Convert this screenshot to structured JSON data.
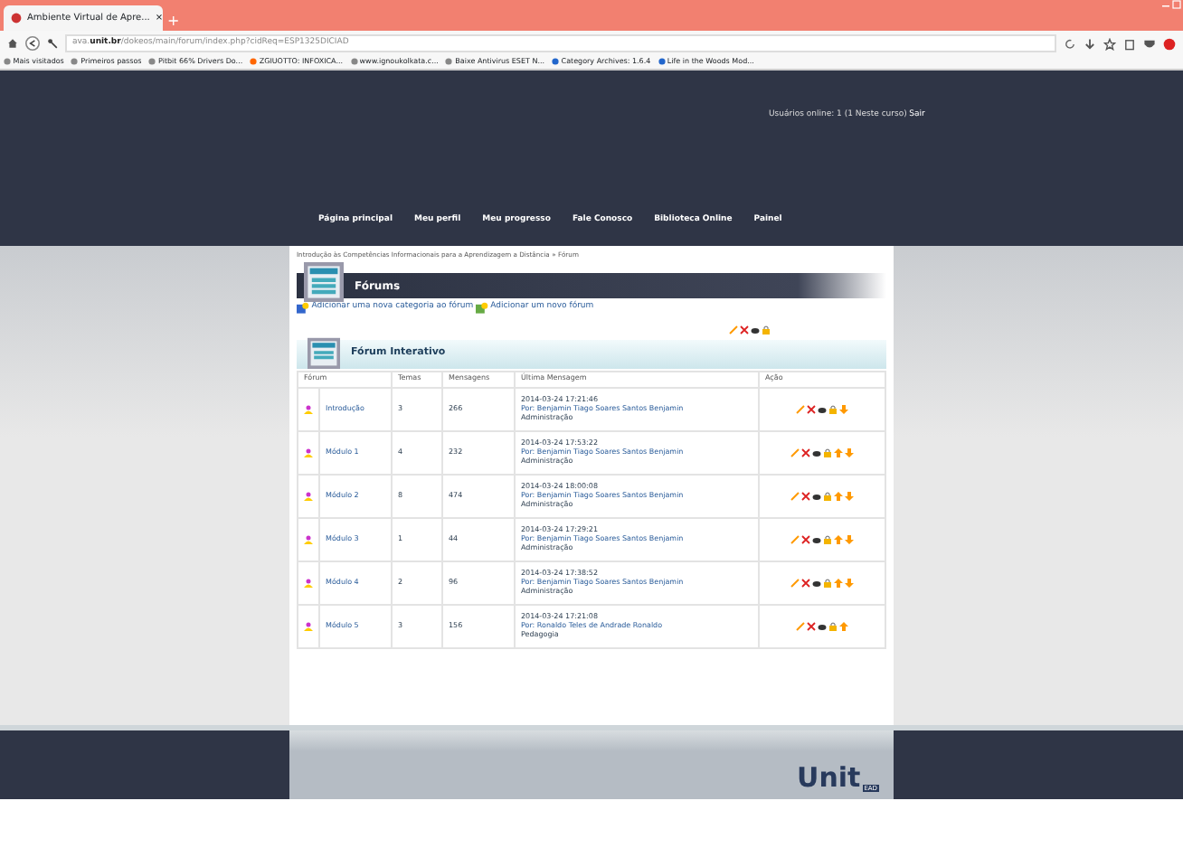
{
  "browser": {
    "tab_title": "Ambiente Virtual de Apre...",
    "tab_close": "×",
    "new_tab": "+",
    "url_prefix": "ava.",
    "url_domain": "unit.br",
    "url_path": "/dokeos/main/forum/index.php?cidReq=ESP1325DICIAD",
    "bookmarks": [
      "Mais visitados",
      "Primeiros passos",
      "Pitbit 66% Drivers Do...",
      "ZGIUOTTO: INFOXICA...",
      "www.ignoukolkata.c...",
      "Baixe Antivirus ESET N...",
      "Category Archives: 1.6.4",
      "Life in the Woods Mod..."
    ]
  },
  "header": {
    "online": "Usuários online: 1 (1 Neste curso)",
    "logout": "Sair"
  },
  "nav": [
    "Página principal",
    "Meu perfil",
    "Meu progresso",
    "Fale Conosco",
    "Biblioteca Online",
    "Painel"
  ],
  "breadcrumb": [
    "Introdução às Competências Informacionais para a Aprendizagem a Distância",
    "Fórum"
  ],
  "breadcrumb_sep": "»",
  "title": "Fórums",
  "links": [
    "Adicionar uma nova categoria ao fórum",
    "Adicionar um novo fórum"
  ],
  "category": "Fórum Interativo",
  "table": {
    "columns": [
      "Fórum",
      "Temas",
      "Mensagens",
      "Última Mensagem",
      "Ação"
    ],
    "rows": [
      {
        "name": "Introdução",
        "topics": "3",
        "posts": "266",
        "date": "2014-03-24 17:21:46",
        "author": "Por: Benjamin Tiago Soares Santos Benjamin",
        "role": "Administração",
        "move_up": false,
        "move_down": true
      },
      {
        "name": "Módulo 1",
        "topics": "4",
        "posts": "232",
        "date": "2014-03-24 17:53:22",
        "author": "Por: Benjamin Tiago Soares Santos Benjamin",
        "role": "Administração",
        "move_up": true,
        "move_down": true
      },
      {
        "name": "Módulo 2",
        "topics": "8",
        "posts": "474",
        "date": "2014-03-24 18:00:08",
        "author": "Por: Benjamin Tiago Soares Santos Benjamin",
        "role": "Administração",
        "move_up": true,
        "move_down": true
      },
      {
        "name": "Módulo 3",
        "topics": "1",
        "posts": "44",
        "date": "2014-03-24 17:29:21",
        "author": "Por: Benjamin Tiago Soares Santos Benjamin",
        "role": "Administração",
        "move_up": true,
        "move_down": true
      },
      {
        "name": "Módulo 4",
        "topics": "2",
        "posts": "96",
        "date": "2014-03-24 17:38:52",
        "author": "Por: Benjamin Tiago Soares Santos Benjamin",
        "role": "Administração",
        "move_up": true,
        "move_down": true
      },
      {
        "name": "Módulo 5",
        "topics": "3",
        "posts": "156",
        "date": "2014-03-24 17:21:08",
        "author": "Por: Ronaldo Teles de Andrade Ronaldo",
        "role": "Pedagogia",
        "move_up": true,
        "move_down": false
      }
    ]
  },
  "footer": {
    "logo": "Unit",
    "logo_badge": "EAD"
  }
}
